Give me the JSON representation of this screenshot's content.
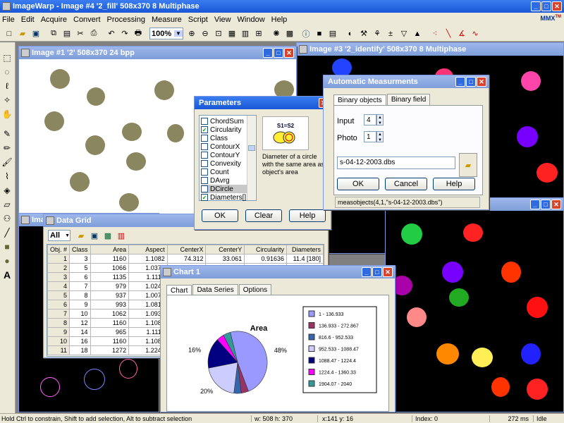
{
  "app": {
    "title": "ImageWarp - Image #4 '2_fill'  508x370  8 Multiphase",
    "menu": [
      "File",
      "Edit",
      "Acquire",
      "Convert",
      "Processing",
      "Measure",
      "Script",
      "View",
      "Window",
      "Help"
    ],
    "zoom": "100%",
    "logo": "MMX",
    "logo_sup": "TM"
  },
  "image1": {
    "title": "Image #1 '2'  508x370  24  bpp"
  },
  "image3": {
    "title": "Image #3 '2_identify'  508x370  8 Multiphase"
  },
  "image_bl": {
    "title": "Imag"
  },
  "parameters": {
    "title": "Parameters",
    "items": [
      {
        "label": "ChordSum",
        "checked": false
      },
      {
        "label": "Circularity",
        "checked": true
      },
      {
        "label": "Class",
        "checked": false
      },
      {
        "label": "ContourX",
        "checked": false
      },
      {
        "label": "ContourY",
        "checked": false
      },
      {
        "label": "Convexity",
        "checked": false
      },
      {
        "label": "Count",
        "checked": false
      },
      {
        "label": "DAvrg",
        "checked": false
      },
      {
        "label": "DCircle",
        "checked": false
      },
      {
        "label": "Diameters[]",
        "checked": true
      }
    ],
    "formula": "S1=S2",
    "description": "Diameter of a circle with the same area as object's area",
    "ok": "OK",
    "clear": "Clear",
    "help": "Help"
  },
  "auto": {
    "title": "Automatic Measurments",
    "tabs": [
      "Binary objects",
      "Binary field"
    ],
    "input_label": "Input",
    "input_value": "4",
    "photo_label": "Photo",
    "photo_value": "1",
    "file": "s-04-12-2003.dbs",
    "ok": "OK",
    "cancel": "Cancel",
    "help": "Help",
    "command": "measobjects(4,1,\"s-04-12-2003.dbs\")"
  },
  "grid": {
    "title": "Data Grid",
    "filter": "All",
    "columns": [
      "Obj. #",
      "Class",
      "Area",
      "Aspect",
      "CenterX",
      "CenterY",
      "Circularity",
      "Diameters"
    ],
    "rows": [
      [
        "1",
        "3",
        "1160",
        "1.1082",
        "74.312",
        "33.061",
        "0.91636",
        "11.4 [180]"
      ],
      [
        "2",
        "5",
        "1066",
        "1.0377",
        "",
        "",
        "",
        ""
      ],
      [
        "3",
        "6",
        "1135",
        "1.1112",
        "",
        "",
        "",
        ""
      ],
      [
        "4",
        "7",
        "979",
        "1.0247",
        "",
        "",
        "",
        ""
      ],
      [
        "5",
        "8",
        "937",
        "1.0072",
        "",
        "",
        "",
        ""
      ],
      [
        "6",
        "9",
        "993",
        "1.0812",
        "",
        "",
        "",
        ""
      ],
      [
        "7",
        "10",
        "1062",
        "1.0933",
        "",
        "",
        "",
        ""
      ],
      [
        "8",
        "12",
        "1160",
        "1.1082",
        "",
        "",
        "",
        ""
      ],
      [
        "9",
        "14",
        "965",
        "1.1113",
        "",
        "",
        "",
        ""
      ],
      [
        "10",
        "16",
        "1160",
        "1.1082",
        "",
        "",
        "",
        ""
      ],
      [
        "11",
        "18",
        "1272",
        "1.2242",
        "",
        "",
        "",
        ""
      ]
    ]
  },
  "chart": {
    "title": "Chart 1",
    "tabs": [
      "Chart",
      "Data Series",
      "Options"
    ]
  },
  "chart_data": {
    "type": "pie",
    "title": "Area",
    "categories": [
      "1 - 136.933",
      "136.933 - 272.867",
      "816.6 - 952.533",
      "952.533 - 1088.47",
      "1088.47 - 1224.4",
      "1224.4 - 1360.33",
      "1904.07 - 2040"
    ],
    "values": [
      48,
      4,
      4,
      20,
      16,
      4,
      4
    ],
    "data_labels": [
      "48%",
      "",
      "",
      "20%",
      "16%",
      "",
      ""
    ],
    "colors": [
      "#9999ff",
      "#993366",
      "#3366aa",
      "#ccccff",
      "#000080",
      "#ff00ff",
      "#339999"
    ],
    "legend": "right"
  },
  "status": {
    "hint": "Hold Ctrl to constrain, Shift to add selection, Alt to subtract selection",
    "size": "w: 508  h: 370",
    "coords": "x:141  y: 16",
    "index": "Index:   0",
    "time": "272 ms",
    "state": "Idle"
  }
}
